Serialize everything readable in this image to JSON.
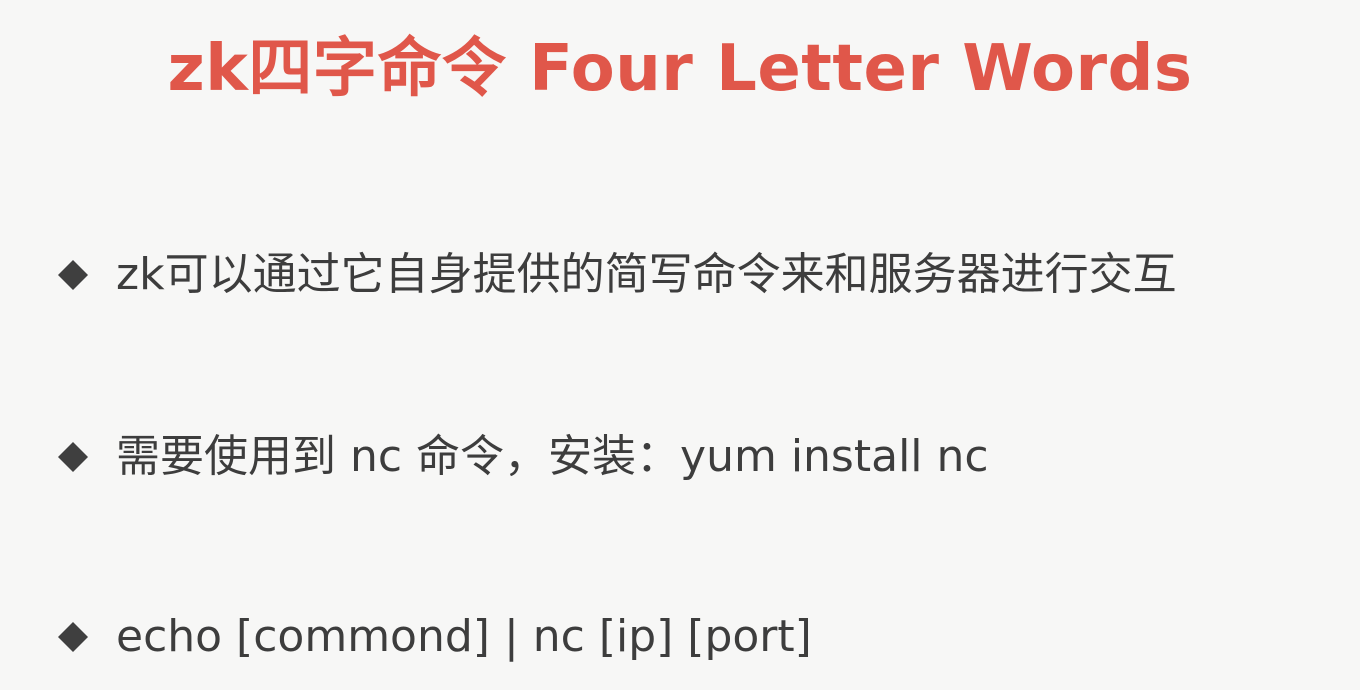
{
  "slide": {
    "title": "zk四字命令 Four Letter Words",
    "title_color": "#e0574a",
    "bullets": [
      {
        "icon": "diamond-bullet-icon",
        "text": "zk可以通过它自身提供的简写命令来和服务器进行交互"
      },
      {
        "icon": "diamond-bullet-icon",
        "text": "需要使用到 nc 命令，安装：yum install nc"
      },
      {
        "icon": "diamond-bullet-icon",
        "text": "echo [commond] | nc [ip] [port]"
      }
    ],
    "text_color": "#3d3d3d"
  }
}
